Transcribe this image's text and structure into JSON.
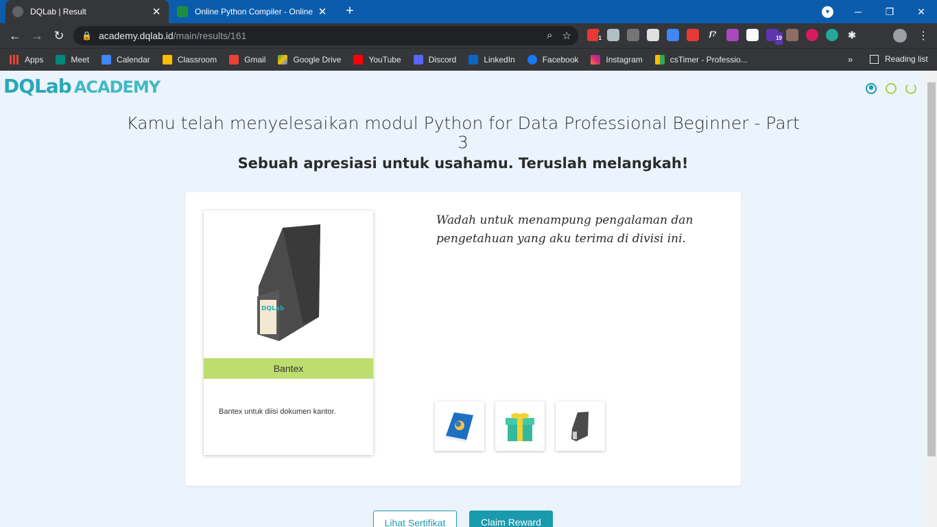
{
  "browser": {
    "tabs": [
      {
        "title": "DQLab | Result"
      },
      {
        "title": "Online Python Compiler - Online"
      }
    ],
    "url_host": "academy.dqlab.id",
    "url_path": "/main/results/161",
    "ext_badge_1": "1",
    "ext_badge_2": "19",
    "bookmarks": [
      "Apps",
      "Meet",
      "Calendar",
      "Classroom",
      "Gmail",
      "Google Drive",
      "YouTube",
      "Discord",
      "LinkedIn",
      "Facebook",
      "Instagram",
      "csTimer - Professio..."
    ],
    "reading_list": "Reading list",
    "more": "»"
  },
  "header": {
    "logo_dq": "DQLab",
    "logo_academy": "ACADEMY"
  },
  "main": {
    "title": "Kamu telah menyelesaikan modul Python for Data Professional Beginner - Part 3",
    "subtitle": "Sebuah apresiasi untuk usahamu. Teruslah melangkah!",
    "card": {
      "name": "Bantex",
      "description": "Bantex untuk diisi dokumen kantor."
    },
    "quote": "Wadah untuk menampung pengalaman dan pengetahuan yang aku terima di divisi ini.",
    "buttons": {
      "certificate": "Lihat Sertifikat",
      "claim": "Claim Reward"
    }
  },
  "colors": {
    "accent": "#1a9aad",
    "card_label": "#bedd6f",
    "chrome_tabstrip": "#0b5cad"
  }
}
